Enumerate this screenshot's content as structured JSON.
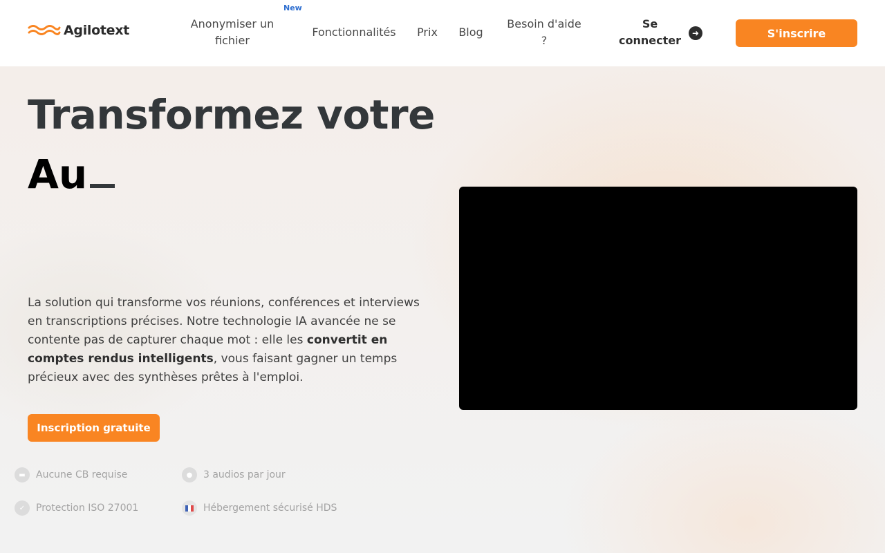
{
  "brand": {
    "name": "Agilotext"
  },
  "nav": {
    "items": [
      {
        "label": "Anonymiser un fichier",
        "badge": "New"
      },
      {
        "label": "Fonctionnalités"
      },
      {
        "label": "Prix"
      },
      {
        "label": "Blog"
      },
      {
        "label": "Besoin d'aide ?"
      }
    ],
    "login_label": "Se connecter",
    "signup_label": "S'inscrire"
  },
  "hero": {
    "title_line1": "Transformez votre",
    "typed_text": "Au",
    "description_part1": "La solution qui transforme vos réunions, conférences et interviews en transcriptions précises. Notre technologie IA avancée ne se contente pas de capturer chaque mot : elle les ",
    "description_bold": "convertit en comptes rendus intelligents",
    "description_part2": ", vous faisant gagner un temps précieux avec des synthèses prêtes à l'emploi.",
    "cta_label": "Inscription gratuite"
  },
  "features": [
    {
      "label": "Aucune CB requise",
      "icon": "card-icon"
    },
    {
      "label": "3 audios par jour",
      "icon": "free-icon"
    },
    {
      "label": "Protection ISO 27001",
      "icon": "shield-icon"
    },
    {
      "label": "Hébergement sécurisé HDS",
      "icon": "french-flag-icon"
    }
  ],
  "colors": {
    "accent": "#f98522",
    "text": "#33373a",
    "badge": "#2f6fd0"
  }
}
